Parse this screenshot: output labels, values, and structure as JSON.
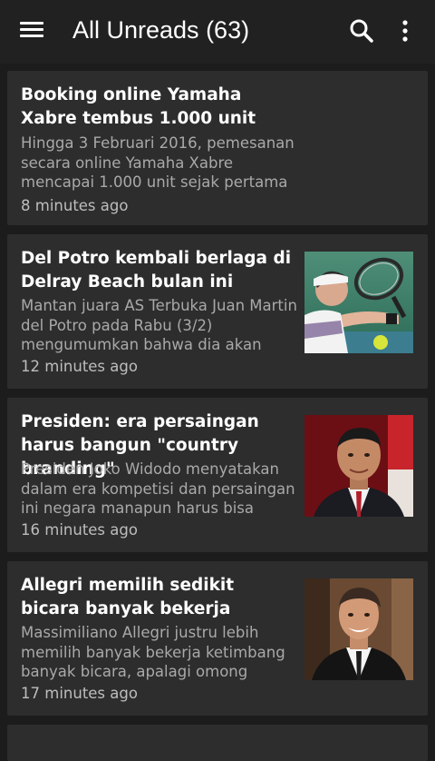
{
  "appbar": {
    "title": "All Unreads (63)",
    "menu_icon": "hamburger-menu-icon",
    "search_icon": "search-icon",
    "more_icon": "more-vert-icon"
  },
  "articles": [
    {
      "headline": "Booking online Yamaha Xabre tembus 1.000 unit",
      "snippet": "Hingga 3 Februari 2016, pemesanan secara online Yamaha Xabre mencapai 1.000 unit sejak pertama",
      "time": "8 minutes ago",
      "has_thumbnail": false
    },
    {
      "headline": "Del Potro kembali berlaga di Delray Beach bulan ini",
      "snippet": "Mantan juara AS Terbuka Juan Martin del Potro pada Rabu (3/2) mengumumkan bahwa dia akan",
      "time": "12 minutes ago",
      "has_thumbnail": true,
      "thumbnail": "tennis-player-photo"
    },
    {
      "headline": "Presiden: era persaingan harus bangun \"country branding\"",
      "snippet": "Presiden Joko Widodo menyatakan dalam era kompetisi dan persaingan ini negara manapun harus bisa",
      "time": "16 minutes ago",
      "has_thumbnail": true,
      "thumbnail": "president-photo"
    },
    {
      "headline": "Allegri memilih sedikit bicara banyak bekerja",
      "snippet": "Massimiliano Allegri justru lebih memilih banyak bekerja ketimbang banyak bicara, apalagi omong",
      "time": "17 minutes ago",
      "has_thumbnail": true,
      "thumbnail": "allegri-photo"
    }
  ]
}
